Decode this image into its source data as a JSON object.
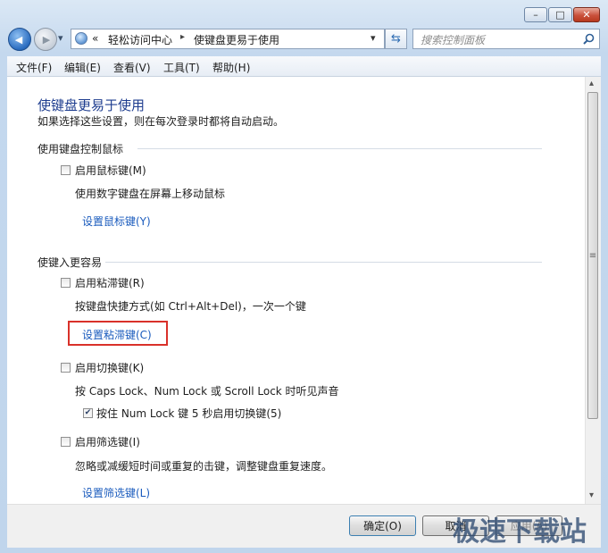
{
  "window": {
    "minimize_glyph": "–",
    "maximize_glyph": "□",
    "close_glyph": "✕"
  },
  "nav": {
    "back_glyph": "◀",
    "forward_glyph": "▶",
    "dropdown_glyph": "▾",
    "breadcrumb_overflow": "«",
    "breadcrumb": [
      "轻松访问中心",
      "使键盘更易于使用"
    ],
    "separator": "▸",
    "address_dropdown": "▾",
    "refresh_glyph": "⇆",
    "search_placeholder": "搜索控制面板"
  },
  "menu": [
    "文件(F)",
    "编辑(E)",
    "查看(V)",
    "工具(T)",
    "帮助(H)"
  ],
  "page": {
    "title": "使键盘更易于使用",
    "subtitle": "如果选择这些设置，则在每次登录时都将自动启动。"
  },
  "section_mouse": {
    "heading": "使用键盘控制鼠标",
    "checkbox_label": "启用鼠标键(M)",
    "checked": false,
    "description": "使用数字键盘在屏幕上移动鼠标",
    "link": "设置鼠标键(Y)"
  },
  "section_typing": {
    "heading": "使键入更容易",
    "sticky": {
      "checkbox_label": "启用粘滞键(R)",
      "checked": false,
      "description": "按键盘快捷方式(如 Ctrl+Alt+Del)，一次一个键",
      "link": "设置粘滞键(C)"
    },
    "toggle": {
      "checkbox_label": "启用切换键(K)",
      "checked": false,
      "description": "按 Caps Lock、Num Lock 或 Scroll Lock 时听见声音",
      "sub_checkbox_label": "按住 Num Lock 键 5 秒启用切换键(5)",
      "sub_checked": true,
      "check_glyph": "✔"
    },
    "filter": {
      "checkbox_label": "启用筛选键(I)",
      "checked": false,
      "description": "忽略或减缓短时间或重复的击键，调整键盘重复速度。",
      "link": "设置筛选键(L)"
    }
  },
  "buttons": {
    "ok": "确定(O)",
    "cancel": "取消",
    "apply": "应用(A)"
  },
  "scrollbar": {
    "up_glyph": "▴",
    "down_glyph": "▾",
    "grip_glyph": "≡"
  },
  "watermark": "极速下载站",
  "colors": {
    "accent_title": "#1e3d8f",
    "link": "#1a5bbd",
    "highlight_box": "#d9312a"
  }
}
